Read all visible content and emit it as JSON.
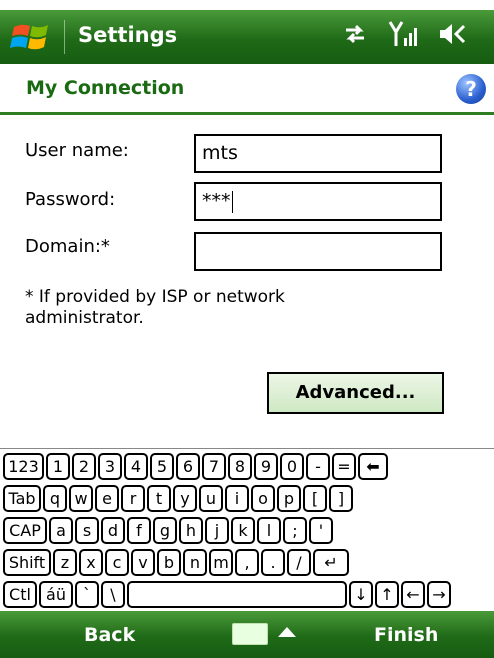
{
  "titlebar": {
    "title": "Settings",
    "icons": [
      "windows-logo-icon",
      "connectivity-icon",
      "signal-icon",
      "volume-icon"
    ]
  },
  "header": {
    "title": "My Connection",
    "help_label": "?"
  },
  "form": {
    "username_label": "User name:",
    "username_value": "mts",
    "password_label": "Password:",
    "password_value": "***",
    "domain_label": "Domain:*",
    "domain_value": "",
    "note": "* If provided by ISP or network administrator.",
    "advanced_label": "Advanced..."
  },
  "keyboard": {
    "row1": [
      "123",
      "1",
      "2",
      "3",
      "4",
      "5",
      "6",
      "7",
      "8",
      "9",
      "0",
      "-",
      "=",
      "⬅"
    ],
    "row2": [
      "Tab",
      "q",
      "w",
      "e",
      "r",
      "t",
      "y",
      "u",
      "i",
      "o",
      "p",
      "[",
      "]"
    ],
    "row3": [
      "CAP",
      "a",
      "s",
      "d",
      "f",
      "g",
      "h",
      "j",
      "k",
      "l",
      ";",
      "'"
    ],
    "row4": [
      "Shift",
      "z",
      "x",
      "c",
      "v",
      "b",
      "n",
      "m",
      ",",
      ".",
      "/",
      "↵"
    ],
    "row5": [
      "Ctl",
      "áü",
      "`",
      "\\",
      "",
      "↓",
      "↑",
      "←",
      "→"
    ]
  },
  "softkeys": {
    "left": "Back",
    "right": "Finish"
  },
  "colors": {
    "bar_green": "#1f6a17",
    "header_green": "#1a6a12",
    "button_green": "#cfe9c4"
  }
}
